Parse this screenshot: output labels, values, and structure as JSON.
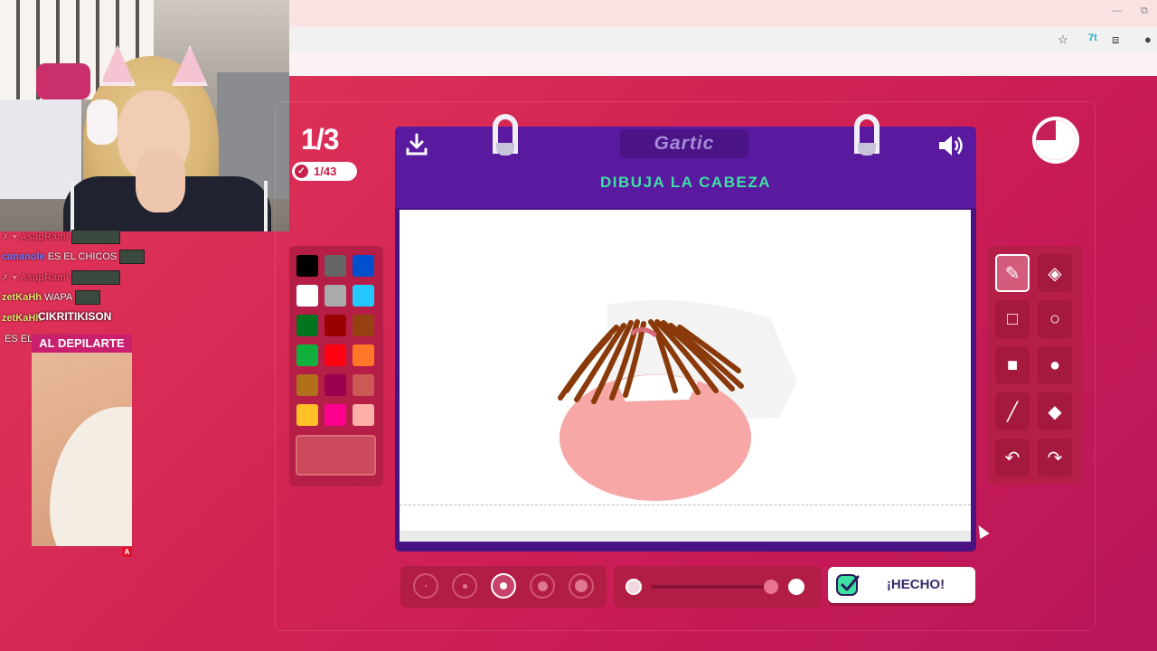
{
  "game": {
    "round": "1/3",
    "players": "1/43",
    "brand": "Gartic",
    "prompt": "DIBUJA LA CABEZA",
    "done_label": "¡HECHO!"
  },
  "palette": {
    "colors": [
      "#000000",
      "#666666",
      "#0050cd",
      "#ffffff",
      "#aaaaaa",
      "#26c9ff",
      "#017420",
      "#990000",
      "#964112",
      "#11b03c",
      "#ff0013",
      "#ff7829",
      "#b0701c",
      "#99004e",
      "#cb5a57",
      "#ffc126",
      "#ff008f",
      "#feafa8"
    ],
    "current": "#cb4b5c"
  },
  "tools": [
    {
      "name": "pencil-tool",
      "icon": "pencil-icon",
      "glyph": "✎",
      "active": true
    },
    {
      "name": "eraser-tool",
      "icon": "eraser-icon",
      "glyph": "◈",
      "active": false
    },
    {
      "name": "rectangle-outline-tool",
      "icon": "square-outline-icon",
      "glyph": "□",
      "active": false
    },
    {
      "name": "circle-outline-tool",
      "icon": "circle-outline-icon",
      "glyph": "○",
      "active": false
    },
    {
      "name": "rectangle-fill-tool",
      "icon": "square-fill-icon",
      "glyph": "■",
      "active": false
    },
    {
      "name": "circle-fill-tool",
      "icon": "circle-fill-icon",
      "glyph": "●",
      "active": false
    },
    {
      "name": "line-tool",
      "icon": "line-icon",
      "glyph": "╱",
      "active": false
    },
    {
      "name": "fill-bucket-tool",
      "icon": "bucket-icon",
      "glyph": "◆",
      "active": false
    },
    {
      "name": "undo-tool",
      "icon": "undo-icon",
      "glyph": "↶",
      "active": false
    },
    {
      "name": "redo-tool",
      "icon": "redo-icon",
      "glyph": "↷",
      "active": false
    }
  ],
  "brush_sizes": {
    "count": 5,
    "selected": 3
  },
  "chat": [
    {
      "user": "AsapRami",
      "text": "",
      "color": "#ff4466"
    },
    {
      "user": "cananole",
      "text": "ES EL CHICOS",
      "color": "#7a7aff"
    },
    {
      "user": "AsapRami",
      "text": "",
      "color": "#ff4466"
    },
    {
      "user": "zetKaHh",
      "text": "WAPA",
      "color": "#e6e36a"
    },
    {
      "user": "zetKaHh",
      "text": "",
      "color": "#e6e36a"
    },
    {
      "user": "",
      "text": "ES EL CHICOS",
      "color": "#7a7aff"
    }
  ],
  "chat_overlay": {
    "title": "CIKRITIKISON",
    "label": "AL DEPILARTE",
    "cam_badge": "A"
  }
}
